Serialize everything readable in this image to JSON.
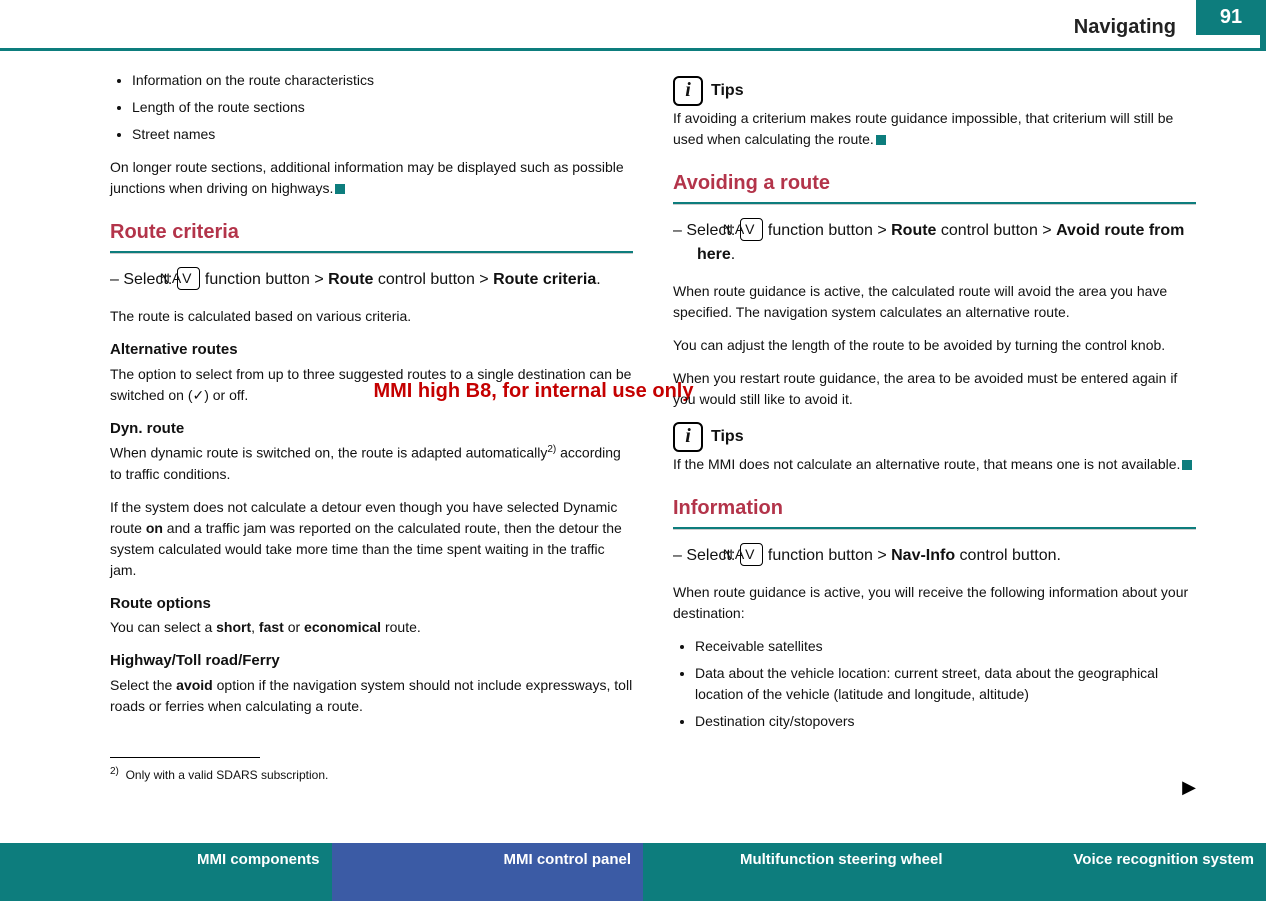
{
  "header": {
    "page_number": "91",
    "title": "Navigating"
  },
  "watermark": "MMI high B8, for internal use only",
  "left": {
    "intro_bullets": [
      "Information on the route characteristics",
      "Length of the route sections",
      "Street names"
    ],
    "intro_para": "On longer route sections, additional information may be displayed such as possible junctions when driving on highways.",
    "route_criteria": {
      "heading": "Route criteria",
      "select_prefix": "–   Select: ",
      "nav": "NAV",
      "select_mid": " function button > ",
      "route_btn": "Route",
      "select_mid2": " control button > ",
      "target": "Route criteria",
      "period": ".",
      "desc": "The route is calculated based on various criteria."
    },
    "alt_routes": {
      "heading": "Alternative routes",
      "body": "The option to select from up to three suggested routes to a single destination can be switched on (✓) or off."
    },
    "dyn_route": {
      "heading": "Dyn. route",
      "p1a": "When dynamic route is switched on, the route is adapted automatically",
      "sup": "2)",
      "p1b": " according to traffic conditions.",
      "p2a": "If the system does not calculate a detour even though you have selected Dynamic route ",
      "on": "on",
      "p2b": " and a traffic jam was reported on the calculated route, then the detour the system calculated would take more time than the time spent waiting in the traffic jam."
    },
    "route_options": {
      "heading": "Route options",
      "pre": "You can select a ",
      "short": "short",
      "c1": ", ",
      "fast": "fast",
      "c2": " or ",
      "econ": "economical",
      "post": " route."
    },
    "highway": {
      "heading": "Highway/Toll road/Ferry",
      "pre": "Select the ",
      "avoid": "avoid",
      "post": " option if the navigation system should not include expressways, toll roads or ferries when calculating a route."
    },
    "footnote": {
      "sup": "2)",
      "text": "Only with a valid SDARS subscription."
    }
  },
  "right": {
    "tips1": {
      "label": "Tips",
      "body": "If avoiding a criterium makes route guidance impossible, that criterium will still be used when calculating the route."
    },
    "avoiding": {
      "heading": "Avoiding a route",
      "select_prefix": "–   Select: ",
      "nav": "NAV",
      "select_mid": " function button > ",
      "route_btn": "Route",
      "select_mid2": " control button > ",
      "target": "Avoid route from here",
      "period": ".",
      "p1": "When route guidance is active, the calculated route will avoid the area you have specified. The navigation system calculates an alternative route.",
      "p2": "You can adjust the length of the route to be avoided by turning the control knob.",
      "p3": "When you restart route guidance, the area to be avoided must be entered again if you would still like to avoid it."
    },
    "tips2": {
      "label": "Tips",
      "body": "If the MMI does not calculate an alternative route, that means one is not available."
    },
    "information": {
      "heading": "Information",
      "select_prefix": "–   Select: ",
      "nav": "NAV",
      "select_mid": " function button > ",
      "navinfo": "Nav-Info",
      "select_post": " control button.",
      "p1": "When route guidance is active, you will receive the following information about your destination:",
      "bullets": [
        "Receivable satellites",
        "Data about the vehicle location: current street, data about the geographical location of the vehicle (latitude and longitude, altitude)",
        "Destination city/stopovers"
      ]
    }
  },
  "bottom_tabs": {
    "t1": "MMI components",
    "t2": "MMI control panel",
    "t3": "Multifunction steering wheel",
    "t4": "Voice recognition system"
  }
}
